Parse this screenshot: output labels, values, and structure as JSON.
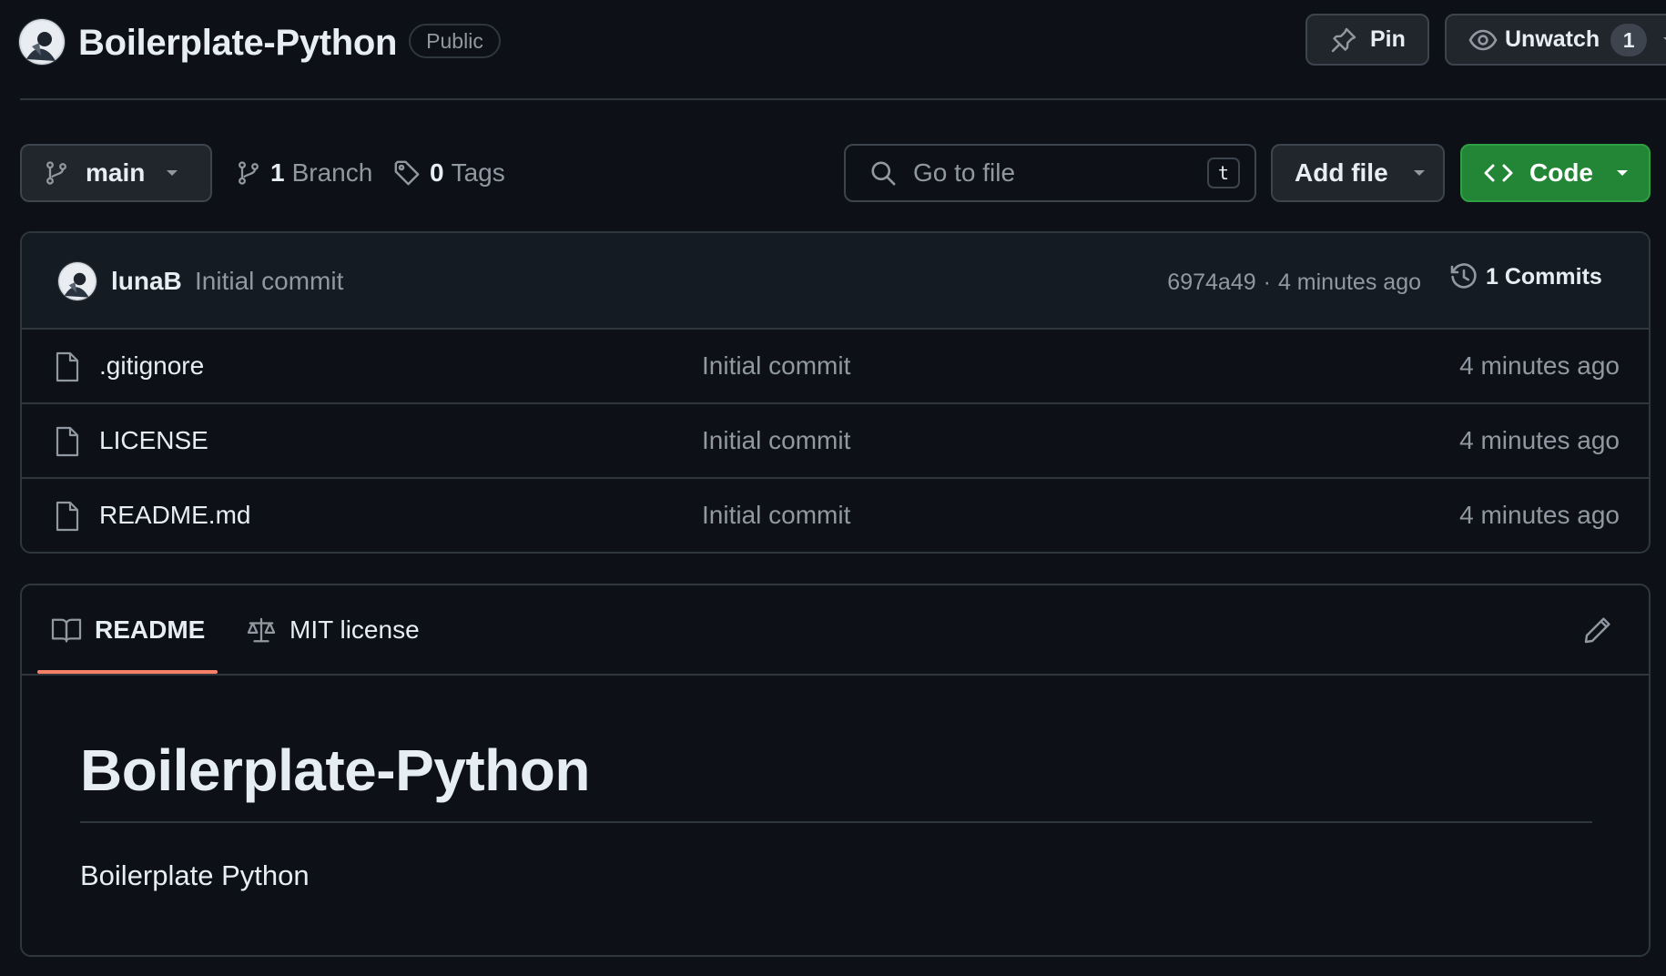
{
  "repo": {
    "name": "Boilerplate-Python",
    "visibility": "Public",
    "pin_label": "Pin",
    "watch_label": "Unwatch",
    "watch_count": "1"
  },
  "toolbar": {
    "branch": "main",
    "branch_count": "1",
    "branch_label": "Branch",
    "tag_count": "0",
    "tag_label": "Tags",
    "search_placeholder": "Go to file",
    "search_shortcut": "t",
    "add_file_label": "Add file",
    "code_label": "Code"
  },
  "latest_commit": {
    "author": "lunaB",
    "message": "Initial commit",
    "hash": "6974a49",
    "separator": "·",
    "time": "4 minutes ago",
    "commits_label": "1 Commits"
  },
  "files": [
    {
      "name": ".gitignore",
      "message": "Initial commit",
      "time": "4 minutes ago"
    },
    {
      "name": "LICENSE",
      "message": "Initial commit",
      "time": "4 minutes ago"
    },
    {
      "name": "README.md",
      "message": "Initial commit",
      "time": "4 minutes ago"
    }
  ],
  "readme": {
    "tabs": [
      {
        "label": "README",
        "icon": "book-icon",
        "active": true
      },
      {
        "label": "MIT license",
        "icon": "law-icon",
        "active": false
      }
    ],
    "heading": "Boilerplate-Python",
    "body": "Boilerplate Python"
  },
  "colors": {
    "background": "#0d1117",
    "border": "#30363d",
    "muted_text": "#9198a1",
    "code_button": "#238636",
    "active_tab_underline": "#f78166"
  }
}
